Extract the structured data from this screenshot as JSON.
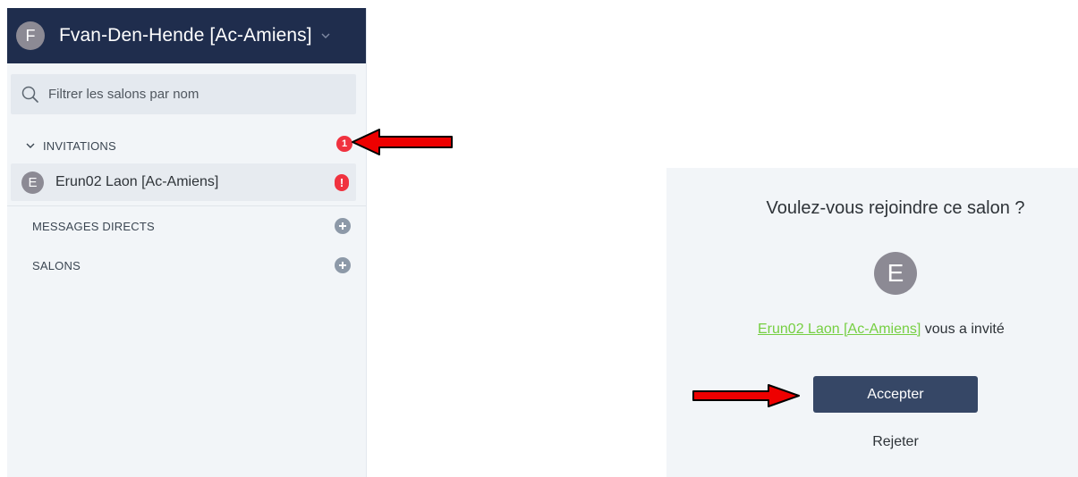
{
  "sidebar": {
    "user_initial": "F",
    "user_name": "Fvan-Den-Hende [Ac-Amiens]",
    "search_placeholder": "Filtrer les salons par nom",
    "invitations": {
      "label": "INVITATIONS",
      "count": "1",
      "items": [
        {
          "initial": "E",
          "name": "Erun02 Laon [Ac-Amiens]",
          "badge": "!"
        }
      ]
    },
    "direct_messages_label": "MESSAGES DIRECTS",
    "rooms_label": "SALONS"
  },
  "invite_panel": {
    "question": "Voulez-vous rejoindre ce salon ?",
    "avatar_initial": "E",
    "inviter_name": "Erun02 Laon [Ac-Amiens]",
    "invite_suffix": " vous a invité",
    "accept_label": "Accepter",
    "reject_label": "Rejeter"
  },
  "colors": {
    "header_bg": "#1f2d4d",
    "sidebar_bg": "#f2f5f8",
    "badge_red": "#f0323f",
    "link_green": "#76cf42",
    "accept_bg": "#364766",
    "annotation_arrow": "#ee0000"
  },
  "icons": [
    "chevron-down-icon",
    "search-icon",
    "plus-circle-icon",
    "arrow-annotation-icon"
  ]
}
